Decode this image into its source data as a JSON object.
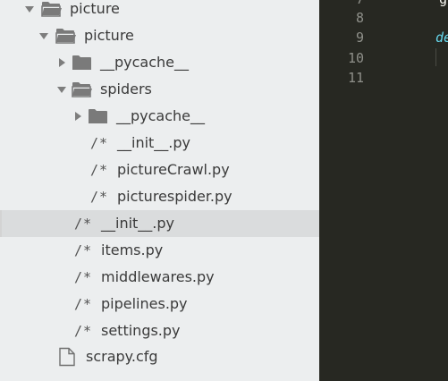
{
  "sidebar": {
    "items": [
      {
        "kind": "folder",
        "open": true,
        "label": "picture"
      },
      {
        "kind": "folder",
        "open": true,
        "label": "picture"
      },
      {
        "kind": "folder",
        "open": false,
        "label": "__pycache__"
      },
      {
        "kind": "folder",
        "open": true,
        "label": "spiders"
      },
      {
        "kind": "folder",
        "open": false,
        "label": "__pycache__"
      },
      {
        "kind": "code",
        "icon": "/*",
        "label": "__init__.py"
      },
      {
        "kind": "code",
        "icon": "/*",
        "label": "pictureCrawl.py"
      },
      {
        "kind": "code",
        "icon": "/*",
        "label": "picturespider.py"
      },
      {
        "kind": "code",
        "icon": "/*",
        "label": "__init__.py",
        "selected": true
      },
      {
        "kind": "code",
        "icon": "/*",
        "label": "items.py"
      },
      {
        "kind": "code",
        "icon": "/*",
        "label": "middlewares.py"
      },
      {
        "kind": "code",
        "icon": "/*",
        "label": "pipelines.py"
      },
      {
        "kind": "code",
        "icon": "/*",
        "label": "settings.py"
      },
      {
        "kind": "file",
        "label": "scrapy.cfg"
      }
    ]
  },
  "editor": {
    "line_numbers": [
      "7",
      "8",
      "9",
      "10",
      "11"
    ],
    "top_fragment": "g",
    "fragment_line9": "de",
    "colors": {
      "background": "#272822",
      "gutter": "#8f908a",
      "keyword": "#66d9ef"
    }
  },
  "colors": {
    "sidebar_bg": "#eceeef",
    "selected_row": "#dadcdd",
    "folder_icon": "#7a7a7a",
    "label": "#3a3a3a"
  }
}
